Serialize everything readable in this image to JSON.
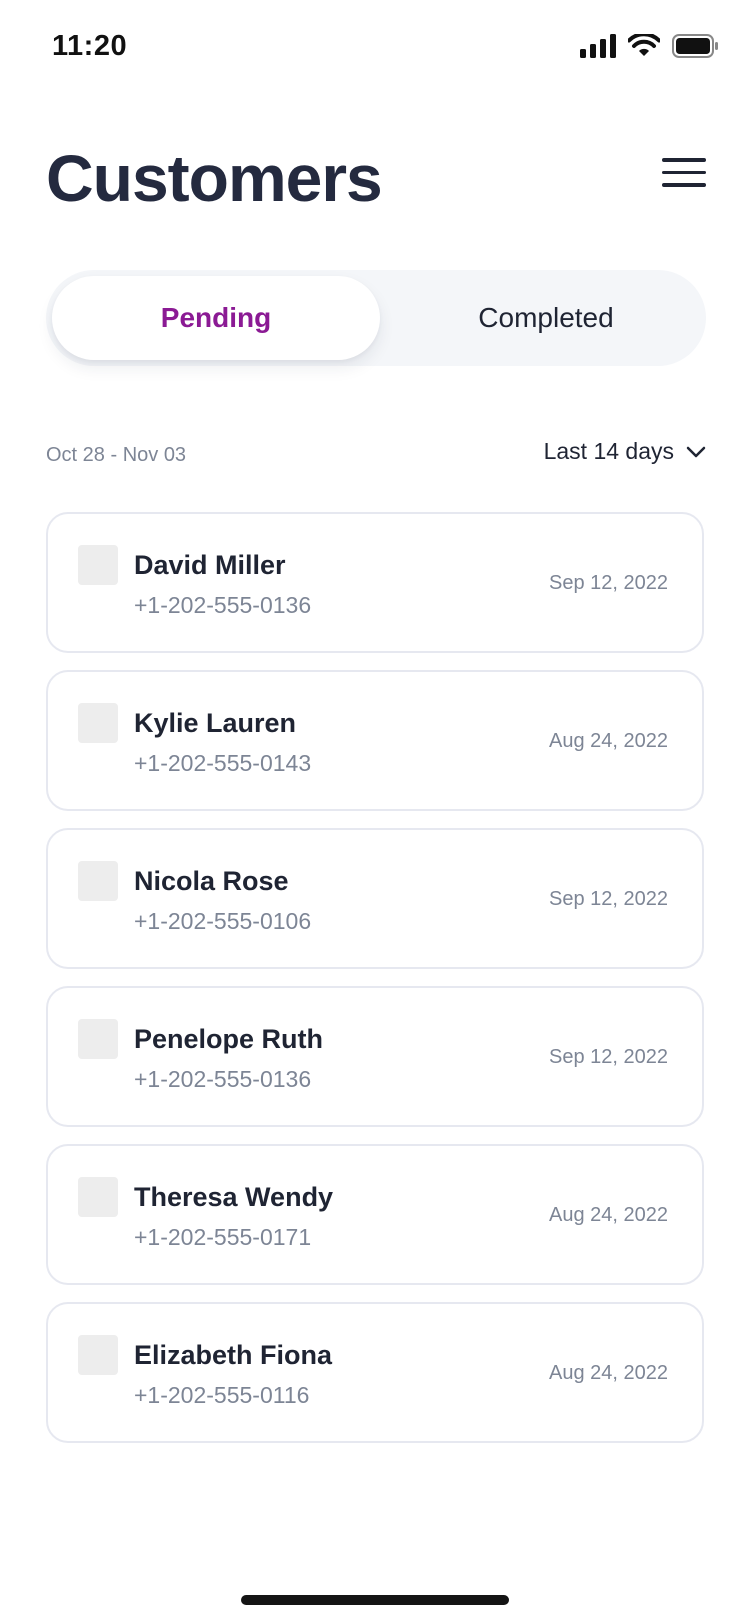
{
  "status": {
    "time": "11:20"
  },
  "header": {
    "title": "Customers"
  },
  "tabs": [
    {
      "label": "Pending",
      "active": true
    },
    {
      "label": "Completed",
      "active": false
    }
  ],
  "filter": {
    "date_range": "Oct 28 - Nov 03",
    "period": "Last 14 days"
  },
  "customers": [
    {
      "name": "David Miller",
      "phone": "+1-202-555-0136",
      "date": "Sep 12, 2022"
    },
    {
      "name": "Kylie Lauren",
      "phone": "+1-202-555-0143",
      "date": "Aug 24, 2022"
    },
    {
      "name": "Nicola Rose",
      "phone": "+1-202-555-0106",
      "date": "Sep 12, 2022"
    },
    {
      "name": "Penelope Ruth",
      "phone": "+1-202-555-0136",
      "date": "Sep 12, 2022"
    },
    {
      "name": "Theresa Wendy",
      "phone": "+1-202-555-0171",
      "date": "Aug 24, 2022"
    },
    {
      "name": "Elizabeth Fiona",
      "phone": "+1-202-555-0116",
      "date": "Aug 24, 2022"
    }
  ],
  "colors": {
    "accent": "#8b1a94",
    "title": "#242a3f",
    "muted": "#7d8595",
    "border": "#e6e8f0"
  }
}
